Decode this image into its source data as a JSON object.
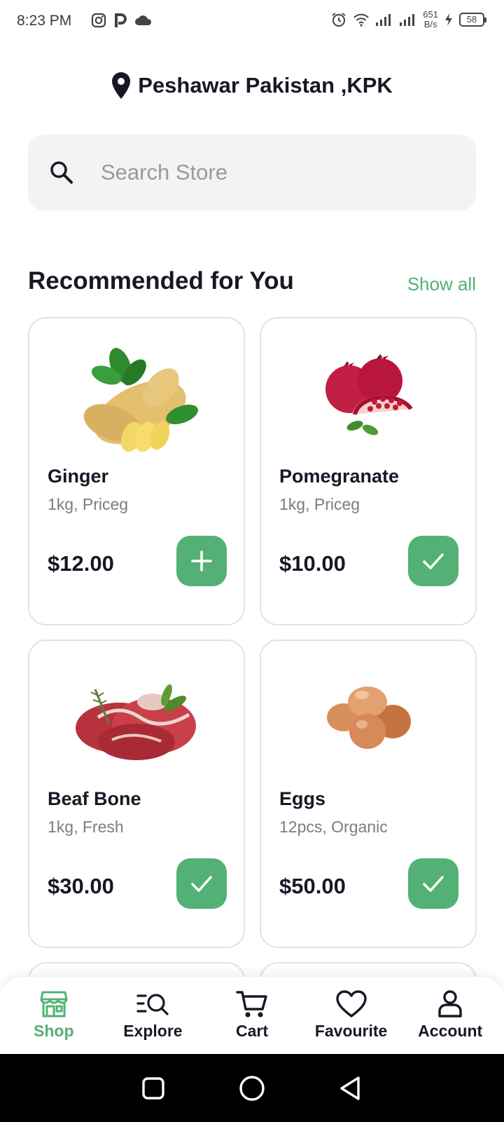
{
  "status_bar": {
    "time": "8:23 PM",
    "net_speed_value": "651",
    "net_speed_unit": "B/s",
    "battery": "58"
  },
  "location": {
    "text": "Peshawar Pakistan ,KPK"
  },
  "search": {
    "placeholder": "Search Store"
  },
  "section": {
    "title": "Recommended for You",
    "show_all": "Show all"
  },
  "products": [
    {
      "name": "Ginger",
      "subtitle": "1kg, Priceg",
      "price": "$12.00",
      "action": "add"
    },
    {
      "name": "Pomegranate",
      "subtitle": "1kg, Priceg",
      "price": "$10.00",
      "action": "added"
    },
    {
      "name": "Beaf Bone",
      "subtitle": "1kg, Fresh",
      "price": "$30.00",
      "action": "added"
    },
    {
      "name": "Eggs",
      "subtitle": "12pcs, Organic",
      "price": "$50.00",
      "action": "added"
    }
  ],
  "bottom_nav": [
    {
      "label": "Shop",
      "icon": "shop-icon",
      "active": true
    },
    {
      "label": "Explore",
      "icon": "explore-icon",
      "active": false
    },
    {
      "label": "Cart",
      "icon": "cart-icon",
      "active": false
    },
    {
      "label": "Favourite",
      "icon": "heart-icon",
      "active": false
    },
    {
      "label": "Account",
      "icon": "account-icon",
      "active": false
    }
  ],
  "colors": {
    "accent": "#53b175",
    "text": "#181725",
    "muted": "#7c7c7c",
    "search_bg": "#f2f3f2"
  }
}
